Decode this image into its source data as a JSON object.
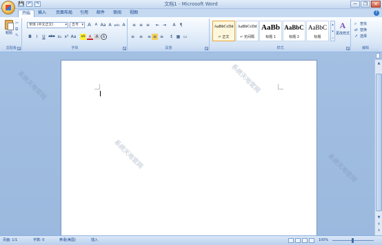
{
  "titlebar": {
    "title": "文档1 - Microsoft Word",
    "qat": [
      "💾",
      "↶",
      "↷"
    ],
    "window_buttons": [
      "─",
      "❐",
      "✕"
    ]
  },
  "tabs": [
    "开始",
    "插入",
    "页面布局",
    "引用",
    "邮件",
    "审阅",
    "视图"
  ],
  "ribbon": {
    "clipboard": {
      "paste": "粘贴",
      "label": "剪贴板"
    },
    "font": {
      "name": "宋体 (中文正文)",
      "size": "五号",
      "label": "字体",
      "row1": [
        "A",
        "A",
        "Aa",
        "A",
        "wén",
        "A"
      ],
      "row2": [
        "B",
        "I",
        "U",
        "abe",
        "x₂",
        "x²",
        "Aa",
        "ab",
        "A",
        "A",
        "A"
      ]
    },
    "paragraph": {
      "label": "段落",
      "row1": [
        "≡",
        "≡",
        "≡",
        "⇤",
        "⇥",
        "A",
        "¶"
      ],
      "row2": [
        "≡",
        "≡",
        "≡",
        "≡",
        "≡",
        "↕",
        "▦",
        "▭"
      ]
    },
    "styles": {
      "label": "样式",
      "items": [
        {
          "sample": "AaBbCcDd",
          "name": "↵ 正文"
        },
        {
          "sample": "AaBbCcDd",
          "name": "↵ 无间隔"
        },
        {
          "sample": "AaBb",
          "name": "标题 1"
        },
        {
          "sample": "AaBbC",
          "name": "标题 2"
        },
        {
          "sample": "AaBbC",
          "name": "标题"
        }
      ],
      "change_styles": "更改样式"
    },
    "editing": {
      "label": "编辑",
      "items": [
        "查找",
        "替换",
        "选择"
      ]
    }
  },
  "statusbar": {
    "page": "页面: 1/1",
    "words": "字数: 0",
    "lang": "英语(美国)",
    "insert": "插入",
    "zoom": "100%"
  },
  "watermark": "系统天地官网"
}
